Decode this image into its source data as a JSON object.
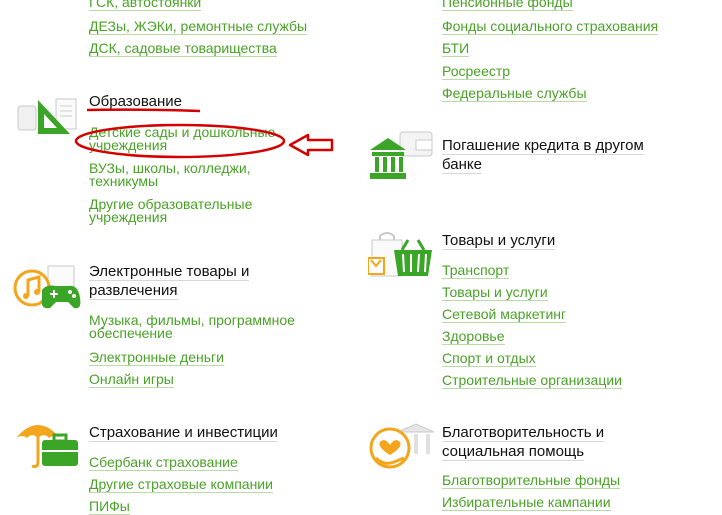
{
  "left": {
    "top_links": [
      "ГСК, автостоянки",
      "ДЕЗы, ЖЭКи, ремонтные службы",
      "ДСК, садовые товарищества"
    ],
    "education": {
      "title": "Образование",
      "links": [
        [
          "Детские сады и дошкольные",
          "учреждения"
        ],
        [
          "ВУЗы, школы, колледжи,",
          "техникумы"
        ],
        [
          "Другие образовательные",
          "учреждения"
        ]
      ]
    },
    "entertainment": {
      "title_lines": [
        "Электронные товары и",
        "развлечения"
      ],
      "links": [
        [
          "Музыка, фильмы, программное",
          "обеспечение"
        ],
        "Электронные деньги",
        "Онлайн игры"
      ]
    },
    "insurance": {
      "title": "Страхование и инвестиции",
      "links": [
        "Сбербанк страхование",
        "Другие страховые компании",
        "ПИФы"
      ]
    }
  },
  "right": {
    "top_links": [
      "Пенсионные фонды",
      "Фонды социального страхования",
      "БТИ",
      "Росреестр",
      "Федеральные службы"
    ],
    "credit": {
      "title_lines": [
        "Погашение кредита в другом",
        "банке"
      ]
    },
    "goods": {
      "title": "Товары и услуги",
      "links": [
        "Транспорт",
        "Товары и услуги",
        "Сетевой маркетинг",
        "Здоровье",
        "Спорт и отдых",
        "Строительные организации"
      ]
    },
    "charity": {
      "title_lines": [
        "Благотворительность и",
        "социальная помощь"
      ],
      "links": [
        "Благотворительные фонды",
        "Избирательные кампании"
      ]
    }
  },
  "icons": {
    "education": "ruler-triangle-icon",
    "entertainment": "gamepad-music-icon",
    "insurance": "umbrella-briefcase-icon",
    "credit": "bank-wallet-icon",
    "goods": "basket-bag-icon",
    "charity": "heart-hand-icon"
  },
  "colors": {
    "link": "#49a326",
    "annotation": "#d40000",
    "icon_green": "#3aa527",
    "icon_orange": "#f3a51b"
  }
}
